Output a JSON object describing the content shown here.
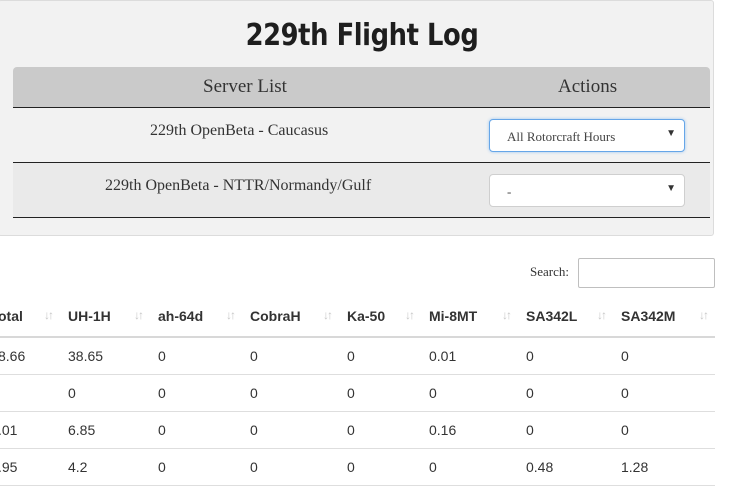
{
  "page": {
    "title": "229th Flight Log"
  },
  "server_table": {
    "headers": {
      "server_list": "Server List",
      "actions": "Actions"
    },
    "rows": [
      {
        "name": "229th OpenBeta - Caucasus",
        "action": "All Rotorcraft Hours"
      },
      {
        "name": "229th OpenBeta - NTTR/Normandy/Gulf",
        "action": "-"
      }
    ]
  },
  "search": {
    "label": "Search:",
    "value": ""
  },
  "hours_table": {
    "columns": [
      "otal",
      "UH-1H",
      "ah-64d",
      "CobraH",
      "Ka-50",
      "Mi-8MT",
      "SA342L",
      "SA342M"
    ],
    "sort_glyph": "↓↑",
    "rows": [
      [
        "8.66",
        "38.65",
        "0",
        "0",
        "0",
        "0.01",
        "0",
        "0"
      ],
      [
        "",
        "0",
        "0",
        "0",
        "0",
        "0",
        "0",
        "0"
      ],
      [
        ".01",
        "6.85",
        "0",
        "0",
        "0",
        "0.16",
        "0",
        "0"
      ],
      [
        ".95",
        "4.2",
        "0",
        "0",
        "0",
        "0",
        "0.48",
        "1.28"
      ]
    ]
  },
  "colors": {
    "focus_border": "#66a6e8",
    "header_band": "#cacaca",
    "panel_bg": "#f2f2f2"
  },
  "icons": {
    "select_arrow": "▼"
  }
}
